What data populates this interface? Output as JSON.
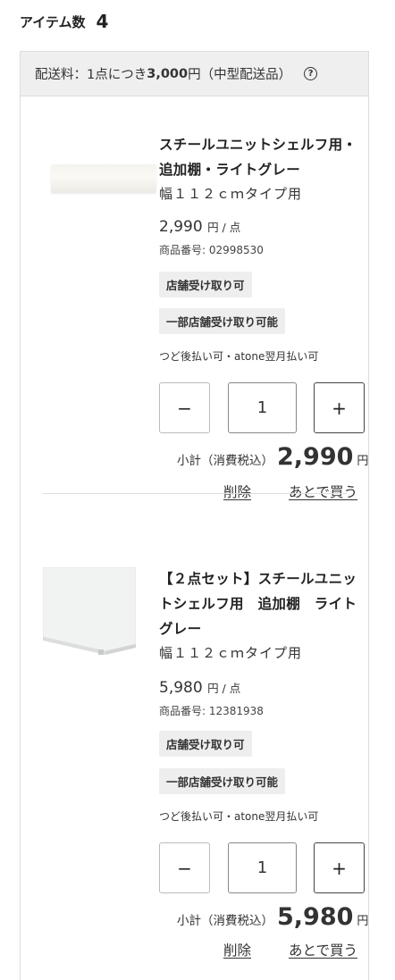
{
  "header": {
    "label": "アイテム数",
    "count": "4"
  },
  "shipping": {
    "prefix": "配送料：1点につき",
    "amount": "3,000",
    "suffix": "円（中型配送品）",
    "help_icon": "question-circle-icon"
  },
  "items": [
    {
      "title": "スチールユニットシェルフ用・追加棚・ライトグレー",
      "subtitle": "幅１１２ｃｍタイプ用",
      "price": "2,990",
      "price_unit": "円 / 点",
      "sku": "商品番号: 02998530",
      "badge_store": "店舗受け取り可",
      "badge_partial": "一部店舗受け取り可能",
      "payment": "つど後払い可・atone翌月払い可",
      "qty_minus": "−",
      "qty_value": "1",
      "qty_plus": "+",
      "subtotal_label": "小計（消費税込）",
      "subtotal_value": "2,990",
      "subtotal_unit": "円",
      "delete_label": "削除",
      "later_label": "あとで買う"
    },
    {
      "title": "【２点セット】スチールユニットシェルフ用　追加棚　ライトグレー",
      "subtitle": "幅１１２ｃｍタイプ用",
      "price": "5,980",
      "price_unit": "円 / 点",
      "sku": "商品番号: 12381938",
      "badge_store": "店舗受け取り可",
      "badge_partial": "一部店舗受け取り可能",
      "payment": "つど後払い可・atone翌月払い可",
      "qty_minus": "−",
      "qty_value": "1",
      "qty_plus": "+",
      "subtotal_label": "小計（消費税込）",
      "subtotal_value": "5,980",
      "subtotal_unit": "円",
      "delete_label": "削除",
      "later_label": "あとで買う"
    }
  ]
}
